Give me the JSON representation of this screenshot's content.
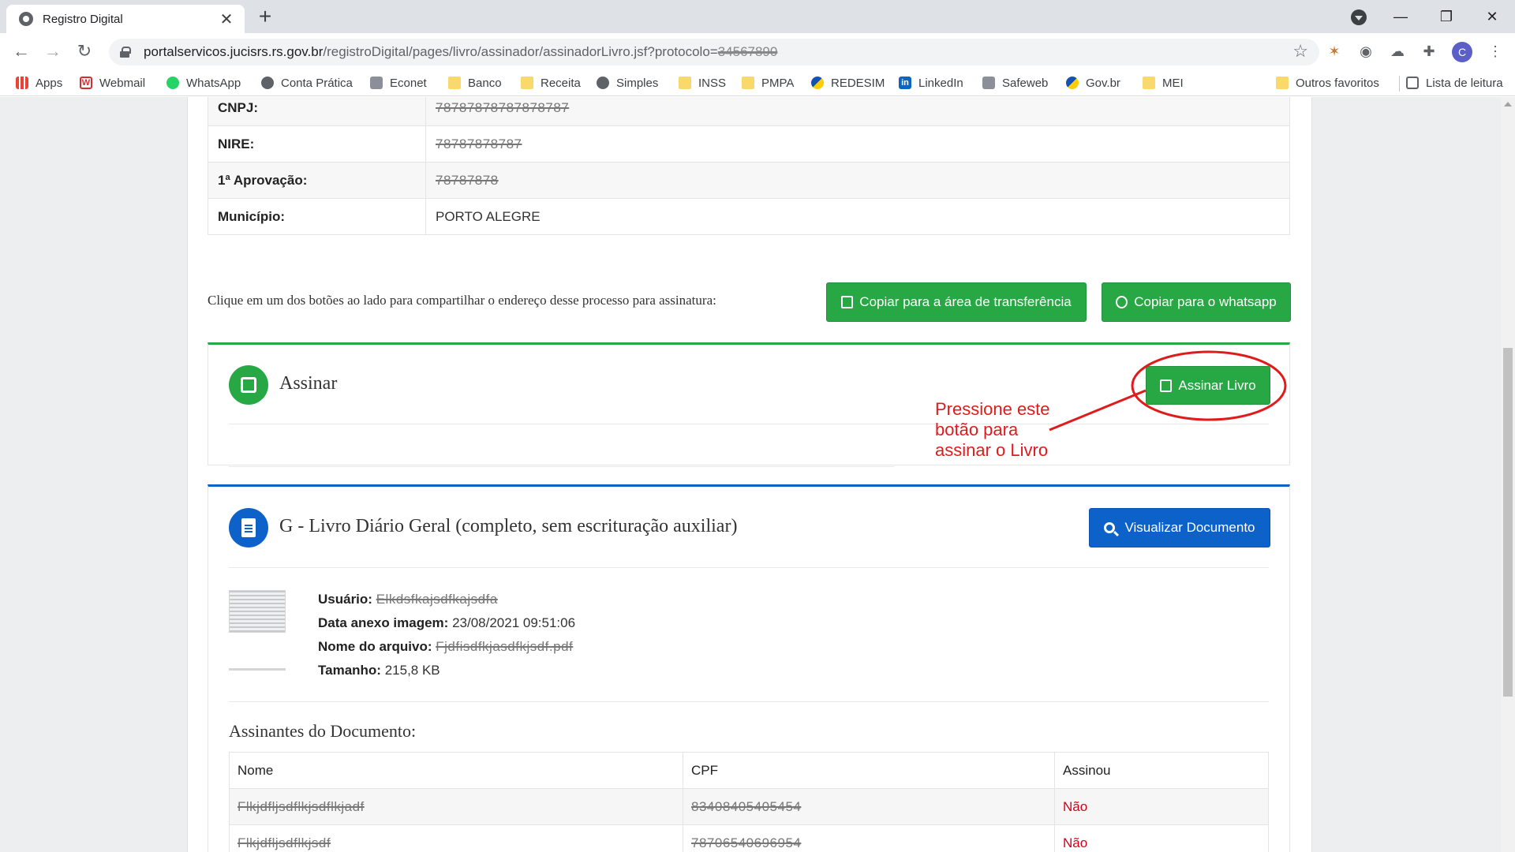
{
  "browser": {
    "tab_title": "Registro Digital",
    "tab_close": "✕",
    "new_tab": "+",
    "url_host": "portalservicos.jucisrs.rs.gov.br",
    "url_path": "/registroDigital/pages/livro/assinador/assinadorLivro.jsf?protocolo=",
    "url_protocol_redacted": "34567890",
    "avatar_letter": "C",
    "window": {
      "minimize": "—",
      "restore": "❐",
      "close": "✕"
    }
  },
  "bookmarks": [
    {
      "label": "Apps",
      "icon": "apps-grid-icon"
    },
    {
      "label": "Webmail",
      "icon": "webmail-w-icon"
    },
    {
      "label": "WhatsApp",
      "icon": "whatsapp-icon"
    },
    {
      "label": "Conta Prática",
      "icon": "globe-icon"
    },
    {
      "label": "Econet",
      "icon": "econet-icon"
    },
    {
      "label": "Banco",
      "icon": "folder-icon"
    },
    {
      "label": "Receita",
      "icon": "folder-icon"
    },
    {
      "label": "Simples",
      "icon": "globe-icon"
    },
    {
      "label": "INSS",
      "icon": "folder-icon"
    },
    {
      "label": "PMPA",
      "icon": "folder-icon"
    },
    {
      "label": "REDESIM",
      "icon": "redesim-icon"
    },
    {
      "label": "LinkedIn",
      "icon": "linkedin-icon"
    },
    {
      "label": "Safeweb",
      "icon": "safeweb-icon"
    },
    {
      "label": "Gov.br",
      "icon": "govbr-icon"
    },
    {
      "label": "MEI",
      "icon": "folder-icon"
    },
    {
      "label": "Outros favoritos",
      "icon": "folder-icon"
    },
    {
      "label": "Lista de leitura",
      "icon": "reading-list-icon"
    }
  ],
  "info_table": [
    {
      "key": "CNPJ:",
      "value": "78787878787878787"
    },
    {
      "key": "NIRE:",
      "value": "78787878787"
    },
    {
      "key": "1ª Aprovação:",
      "value": "78787878"
    },
    {
      "key": "Município:",
      "value": "PORTO ALEGRE"
    }
  ],
  "share": {
    "text": "Clique em um dos botões ao lado para compartilhar o endereço desse processo para assinatura:",
    "copy_clipboard": "Copiar para a área de transferência",
    "copy_whatsapp": "Copiar para o whatsapp"
  },
  "sign_panel": {
    "title": "Assinar",
    "button": "Assinar Livro",
    "annotation": [
      "Pressione este",
      "botão para",
      "assinar o Livro"
    ],
    "annotation_color": "#e01b1b"
  },
  "document": {
    "title": "G - Livro Diário Geral (completo, sem escrituração auxiliar)",
    "view_button": "Visualizar Documento",
    "user_label": "Usuário:",
    "user_value": "Elkdsfkajsdfkajsdfa",
    "date_label": "Data anexo imagem:",
    "date_value": "23/08/2021 09:51:06",
    "file_label": "Nome do arquivo:",
    "file_value": "Fjdfisdfkjasdfkjsdf.pdf",
    "size_label": "Tamanho:",
    "size_value": "215,8 KB"
  },
  "signers": {
    "heading": "Assinantes do Documento:",
    "columns": [
      "Nome",
      "CPF",
      "Assinou"
    ],
    "rows": [
      {
        "name": "Flkjdfljsdflkjsdflkjadf",
        "cpf": "83408405405454",
        "signed": "Não"
      },
      {
        "name": "Flkjdfljsdflkjsdf",
        "cpf": "78706540696954",
        "signed": "Não"
      }
    ]
  },
  "colors": {
    "green": "#28a745",
    "blue": "#0d62c9",
    "red": "#d0021b"
  }
}
